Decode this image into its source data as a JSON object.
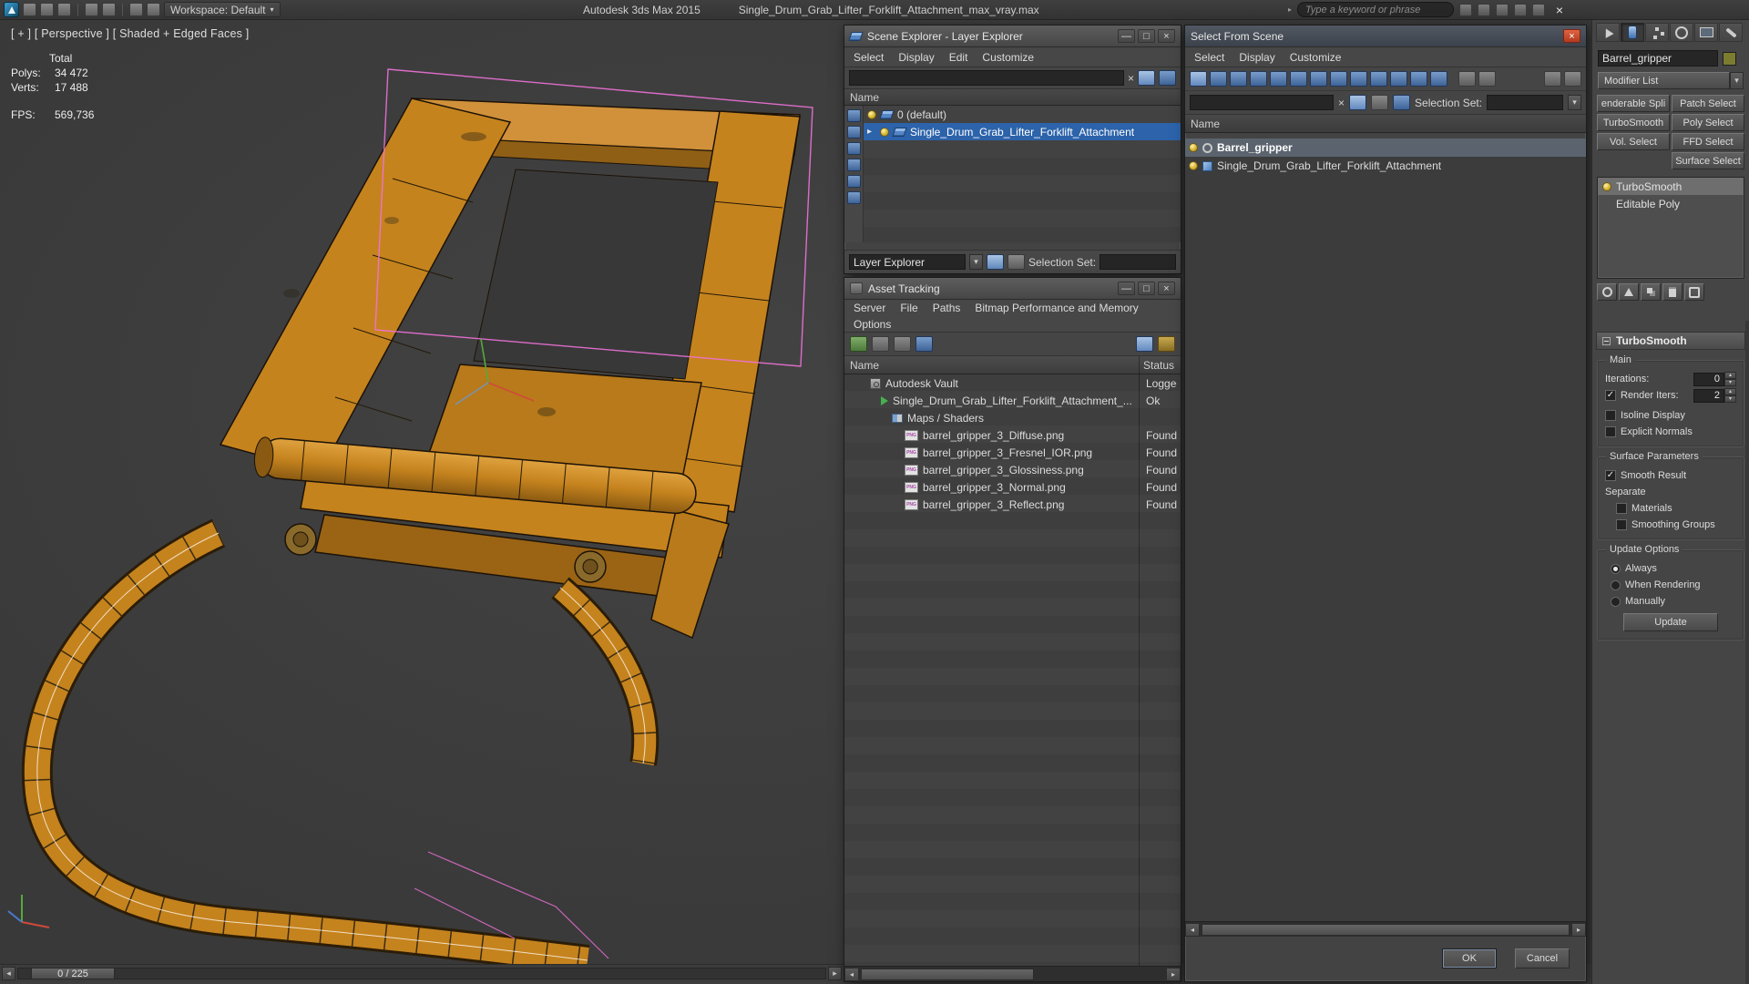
{
  "titlebar": {
    "app_title": "Autodesk 3ds Max 2015",
    "file_title": "Single_Drum_Grab_Lifter_Forklift_Attachment_max_vray.max",
    "workspace_label": "Workspace: Default",
    "search_placeholder": "Type a keyword or phrase"
  },
  "viewport": {
    "label": "[ + ] [ Perspective ] [ Shaded + Edged Faces ]",
    "stats": {
      "total_label": "Total",
      "polys_label": "Polys:",
      "polys_value": "34 472",
      "verts_label": "Verts:",
      "verts_value": "17 488",
      "fps_label": "FPS:",
      "fps_value": "569,736"
    },
    "time_slider": {
      "frame_indicator": "0 / 225"
    },
    "model_colors": {
      "body": "#c5831e",
      "edges": "#1c1208",
      "selection_gizmo": "#ef72d8"
    }
  },
  "scene_explorer": {
    "title": "Scene Explorer - Layer Explorer",
    "menus": [
      "Select",
      "Display",
      "Edit",
      "Customize"
    ],
    "name_column": "Name",
    "rows": [
      {
        "label": "0 (default)",
        "selected": false
      },
      {
        "label": "Single_Drum_Grab_Lifter_Forklift_Attachment",
        "selected": true
      }
    ],
    "footer": {
      "mode_combo": "Layer Explorer",
      "selection_set_label": "Selection Set:"
    }
  },
  "asset_tracking": {
    "title": "Asset Tracking",
    "menus_line1": [
      "Server",
      "File",
      "Paths",
      "Bitmap Performance and Memory"
    ],
    "menus_line2": [
      "Options"
    ],
    "columns": {
      "name": "Name",
      "status": "Status"
    },
    "rows": [
      {
        "name": "Autodesk Vault",
        "status": "Logged"
      },
      {
        "name": "Single_Drum_Grab_Lifter_Forklift_Attachment_...",
        "status": "Ok"
      },
      {
        "name": "Maps / Shaders",
        "status": ""
      },
      {
        "name": "barrel_gripper_3_Diffuse.png",
        "status": "Found"
      },
      {
        "name": "barrel_gripper_3_Fresnel_IOR.png",
        "status": "Found"
      },
      {
        "name": "barrel_gripper_3_Glossiness.png",
        "status": "Found"
      },
      {
        "name": "barrel_gripper_3_Normal.png",
        "status": "Found"
      },
      {
        "name": "barrel_gripper_3_Reflect.png",
        "status": "Found"
      }
    ]
  },
  "select_from_scene": {
    "title": "Select From Scene",
    "menus": [
      "Select",
      "Display",
      "Customize"
    ],
    "selection_set_label": "Selection Set:",
    "name_column": "Name",
    "rows": [
      {
        "label": "Barrel_gripper",
        "selected": true
      },
      {
        "label": "Single_Drum_Grab_Lifter_Forklift_Attachment",
        "selected": false
      }
    ],
    "ok_label": "OK",
    "cancel_label": "Cancel"
  },
  "command_panel": {
    "object_name": "Barrel_gripper",
    "modifier_list_label": "Modifier List",
    "modifier_buttons": [
      "enderable Spli",
      "Patch Select",
      "TurboSmooth",
      "Poly Select",
      "Vol. Select",
      "FFD Select",
      "Surface Select"
    ],
    "stack": [
      {
        "label": "TurboSmooth",
        "selected": true
      },
      {
        "label": "Editable Poly",
        "selected": false
      }
    ],
    "turbosmooth": {
      "rollout_title": "TurboSmooth",
      "main_group": "Main",
      "iterations_label": "Iterations:",
      "iterations_value": "0",
      "render_iters_label": "Render Iters:",
      "render_iters_value": "2",
      "isoline_label": "Isoline Display",
      "explicit_normals_label": "Explicit Normals",
      "surface_parameters_group": "Surface Parameters",
      "smooth_result_label": "Smooth Result",
      "separate_label": "Separate",
      "materials_label": "Materials",
      "smoothing_groups_label": "Smoothing Groups",
      "update_options_group": "Update Options",
      "always_label": "Always",
      "when_rendering_label": "When Rendering",
      "manually_label": "Manually",
      "update_button": "Update"
    }
  }
}
